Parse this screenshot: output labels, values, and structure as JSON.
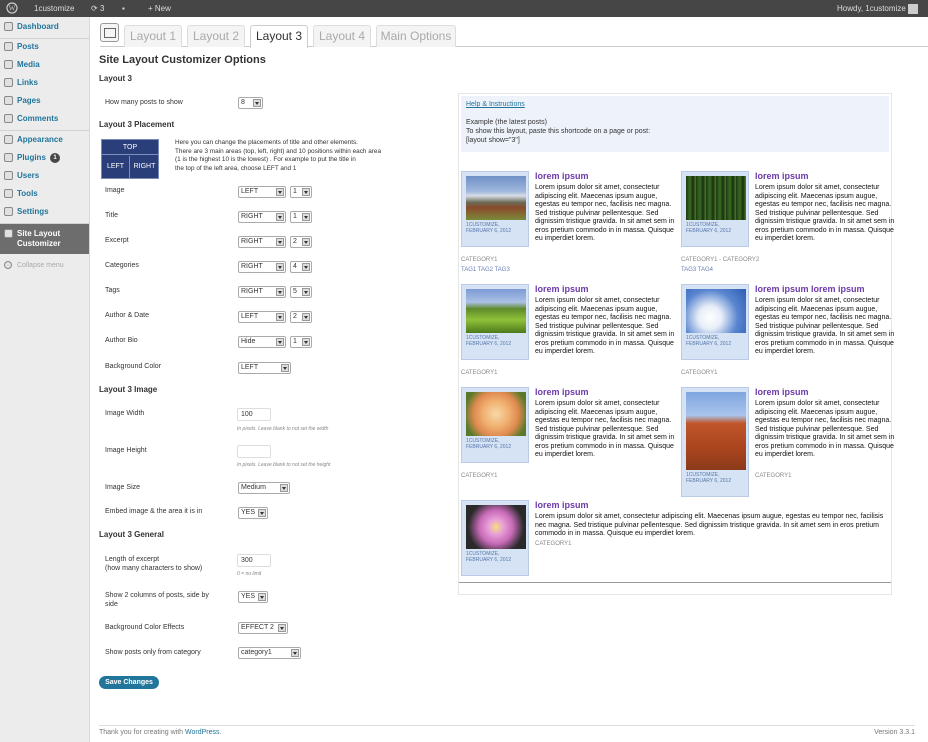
{
  "adminbar": {
    "site_name": "1customize",
    "updates_count": "3",
    "new_label": "New",
    "howdy": "Howdy, 1customize"
  },
  "sidebar": {
    "items": [
      {
        "label": "Dashboard",
        "icon": "dashboard-icon"
      },
      {
        "label": "Posts",
        "icon": "pin-icon"
      },
      {
        "label": "Media",
        "icon": "media-icon"
      },
      {
        "label": "Links",
        "icon": "link-icon"
      },
      {
        "label": "Pages",
        "icon": "pages-icon"
      },
      {
        "label": "Comments",
        "icon": "comments-icon"
      },
      {
        "label": "Appearance",
        "icon": "appearance-icon"
      },
      {
        "label": "Plugins",
        "icon": "plugin-icon",
        "badge": "1"
      },
      {
        "label": "Users",
        "icon": "users-icon"
      },
      {
        "label": "Tools",
        "icon": "tools-icon"
      },
      {
        "label": "Settings",
        "icon": "settings-icon"
      },
      {
        "label": "Site Layout Customizer",
        "icon": "gear-icon"
      },
      {
        "label": "Collapse menu",
        "icon": "collapse-icon"
      }
    ]
  },
  "tabs": [
    "Layout 1",
    "Layout 2",
    "Layout 3",
    "Layout 4",
    "Main Options"
  ],
  "page_title": "Site Layout Customizer Options",
  "section_layout": "Layout 3",
  "posts_count_label": "How many posts to show",
  "posts_count_value": "8",
  "section_placement": "Layout 3 Placement",
  "placement_diagram": {
    "top": "TOP",
    "left": "LEFT",
    "right": "RIGHT"
  },
  "placement_help": [
    "Here you can change the placements of title and other elements.",
    "There are 3 main areas (top, left, right) and 10 positions within each area",
    "(1 is the highest 10 is the lowest) . For example to put the title in",
    "the top of the left area, choose LEFT and 1"
  ],
  "placement_rows": [
    {
      "label": "Image",
      "area": "LEFT",
      "pos": "1"
    },
    {
      "label": "Title",
      "area": "RIGHT",
      "pos": "1"
    },
    {
      "label": "Excerpt",
      "area": "RIGHT",
      "pos": "2"
    },
    {
      "label": "Categories",
      "area": "RIGHT",
      "pos": "4"
    },
    {
      "label": "Tags",
      "area": "RIGHT",
      "pos": "5"
    },
    {
      "label": "Author & Date",
      "area": "LEFT",
      "pos": "2"
    },
    {
      "label": "Author Bio",
      "area": "Hide",
      "pos": "1"
    },
    {
      "label": "Background Color",
      "area": "LEFT"
    }
  ],
  "section_image": "Layout 3 Image",
  "image_width_label": "Image Width",
  "image_width_value": "100",
  "image_width_hint": "In pixels. Leave blank to not set the width",
  "image_height_label": "Image Height",
  "image_height_value": "",
  "image_height_hint": "In pixels. Leave blank to not set the height",
  "image_size_label": "Image Size",
  "image_size_value": "Medium",
  "embed_label": "Embed image & the area it is in",
  "embed_value": "YES",
  "section_general": "Layout 3 General",
  "excerpt_label_1": "Length of excerpt",
  "excerpt_label_2": "(how many characters to show)",
  "excerpt_value": "300",
  "excerpt_hint": "0 = no limit",
  "two_col_label_1": "Show 2 columns of posts, side by",
  "two_col_label_2": "side",
  "two_col_value": "YES",
  "bg_effects_label": "Background Color Effects",
  "bg_effects_value": "EFFECT 2",
  "category_label": "Show posts only from category",
  "category_value": "category1",
  "save_label": "Save Changes",
  "footer_thanks": "Thank you for creating with ",
  "footer_link": "WordPress",
  "footer_version": "Version 3.3.1",
  "preview": {
    "help_link": "Help & Instructions",
    "example": "Example (the latest posts)",
    "instructions": "To show this layout, paste this shortcode on a page or post:",
    "shortcode": "[layout show=\"3\"]",
    "lorem_short": "Lorem ipsum dolor sit amet, consectetur adipiscing elit. Maecenas ipsum augue, egestas eu tempor nec, facilisis nec magna. Sed tristique pulvinar pellentesque. Sed dignissim tristique gravida. In sit amet sem in eros pretium commodo in in massa. Quisque eu imperdiet lorem.",
    "posts": [
      {
        "title": "lorem ipsum",
        "author": "1CUSTOMIZE,",
        "date": "FEBRUARY 6, 2012",
        "cat": "CATEGORY1",
        "tags": "TAG1 TAG2 TAG3"
      },
      {
        "title": "lorem ipsum",
        "author": "1CUSTOMIZE,",
        "date": "FEBRUARY 6, 2012",
        "cat": "CATEGORY1 - CATEGORY2",
        "tags": "TAG3 TAG4"
      },
      {
        "title": "lorem ipsum",
        "author": "1CUSTOMIZE,",
        "date": "FEBRUARY 6, 2012",
        "cat": "CATEGORY1",
        "tags": ""
      },
      {
        "title": "lorem ipsum lorem ipsum",
        "author": "1CUSTOMIZE,",
        "date": "FEBRUARY 6, 2012",
        "cat": "CATEGORY1",
        "tags": ""
      },
      {
        "title": "lorem ipsum",
        "author": "1CUSTOMIZE,",
        "date": "FEBRUARY 6, 2012",
        "cat": "CATEGORY1",
        "tags": ""
      },
      {
        "title": "lorem ipsum",
        "author": "1CUSTOMIZE,",
        "date": "FEBRUARY 6, 2012",
        "cat": "CATEGORY1",
        "tags": ""
      },
      {
        "title": "lorem ipsum",
        "author": "1CUSTOMIZE,",
        "date": "FEBRUARY 6, 2012",
        "cat": "CATEGORY1",
        "tags": ""
      }
    ]
  },
  "colors": {
    "accent": "#21759b",
    "post_title": "#6b3aa8",
    "admin_bar": "#464646"
  }
}
